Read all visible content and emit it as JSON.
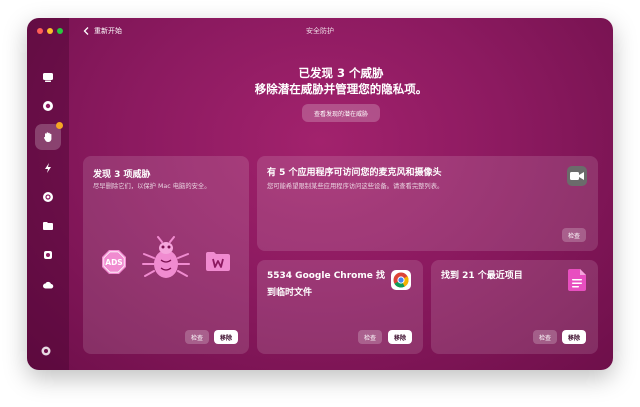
{
  "window": {
    "title": "安全防护",
    "back_label": "重新开始"
  },
  "sidebar": {
    "items": [
      {
        "icon": "disk-icon"
      },
      {
        "icon": "shield-icon"
      },
      {
        "icon": "hand-icon",
        "active": true
      },
      {
        "icon": "lightning-icon"
      },
      {
        "icon": "globe-icon"
      },
      {
        "icon": "folder-icon"
      },
      {
        "icon": "trash-icon"
      },
      {
        "icon": "cloud-icon"
      }
    ],
    "bottom_icon": "settings-icon"
  },
  "main": {
    "headline_line1": "已发现 3 个威胁",
    "headline_line2": "移除潜在威胁并管理您的隐私项。",
    "review_button": "查看发现的潜在威胁"
  },
  "cards": {
    "threats": {
      "title": "发现 3 项威胁",
      "desc": "尽早删除它们，以保护 Mac 电脑的安全。",
      "ads_label": "ADS",
      "check_label": "检查",
      "remove_label": "移除"
    },
    "mic_camera": {
      "title": "有 5 个应用程序可访问您的麦克风和摄像头",
      "desc": "您可能希望限制某些应用程序访问这些设备。请查看完整列表。",
      "check_label": "检查"
    },
    "chrome": {
      "title_line1": "5534 Google Chrome 找",
      "title_line2": "到临时文件",
      "check_label": "检查",
      "remove_label": "移除"
    },
    "recent": {
      "title": "找到 21 个最近项目",
      "check_label": "检查",
      "remove_label": "移除"
    }
  },
  "colors": {
    "background": "#8c1a60",
    "accent_badge": "#f5a623",
    "bug_pink": "#f08bd0"
  }
}
